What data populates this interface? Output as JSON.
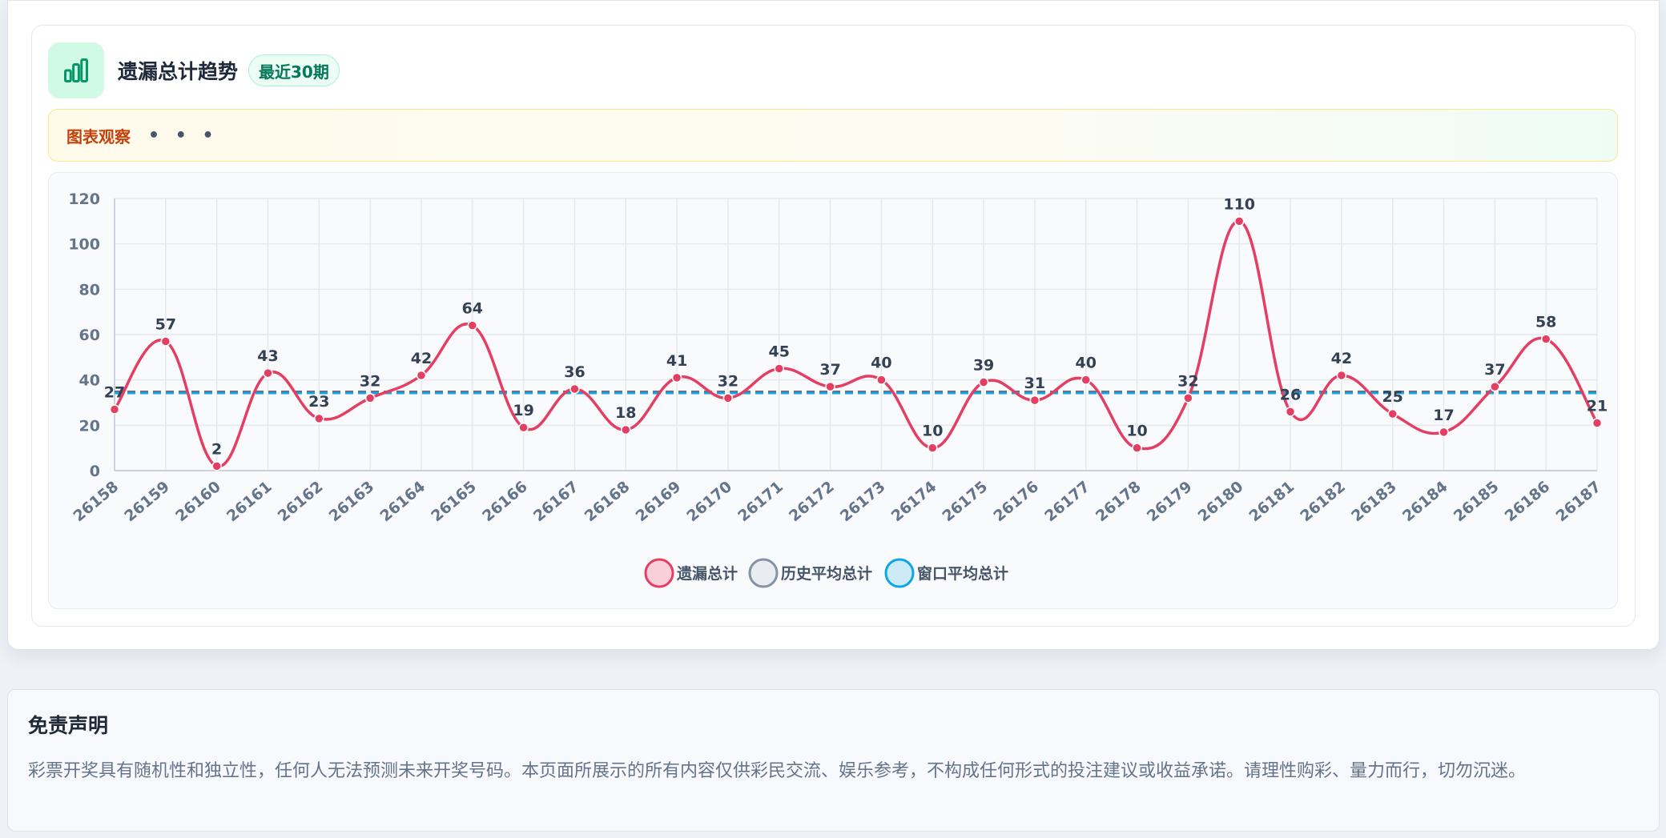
{
  "header": {
    "title": "遗漏总计趋势",
    "badge": "最近30期",
    "icon": "bar-chart-icon"
  },
  "observation": {
    "label": "图表观察",
    "placeholder": "• • •"
  },
  "chart_data": {
    "type": "line",
    "categories": [
      "26158",
      "26159",
      "26160",
      "26161",
      "26162",
      "26163",
      "26164",
      "26165",
      "26166",
      "26167",
      "26168",
      "26169",
      "26170",
      "26171",
      "26172",
      "26173",
      "26174",
      "26175",
      "26176",
      "26177",
      "26178",
      "26179",
      "26180",
      "26181",
      "26182",
      "26183",
      "26184",
      "26185",
      "26186",
      "26187"
    ],
    "series": [
      {
        "name": "遗漏总计",
        "color": "#e53e63",
        "values": [
          27,
          57,
          2,
          43,
          23,
          32,
          42,
          64,
          19,
          36,
          18,
          41,
          32,
          45,
          37,
          40,
          10,
          39,
          31,
          40,
          10,
          32,
          110,
          26,
          42,
          25,
          17,
          37,
          58,
          21
        ]
      },
      {
        "name": "历史平均总计",
        "color": "#64748b",
        "constant": 34.5
      },
      {
        "name": "窗口平均总计",
        "color": "#0ea5e9",
        "constant": 34.5
      }
    ],
    "ylim": [
      0,
      120
    ],
    "yticks": [
      0,
      20,
      40,
      60,
      80,
      100,
      120
    ],
    "grid": true,
    "legend": "bottom-center",
    "data_labels": true
  },
  "disclaimer": {
    "title": "免责声明",
    "body": "彩票开奖具有随机性和独立性，任何人无法预测未来开奖号码。本页面所展示的所有内容仅供彩民交流、娱乐参考，不构成任何形式的投注建议或收益承诺。请理性购彩、量力而行，切勿沉迷。"
  }
}
